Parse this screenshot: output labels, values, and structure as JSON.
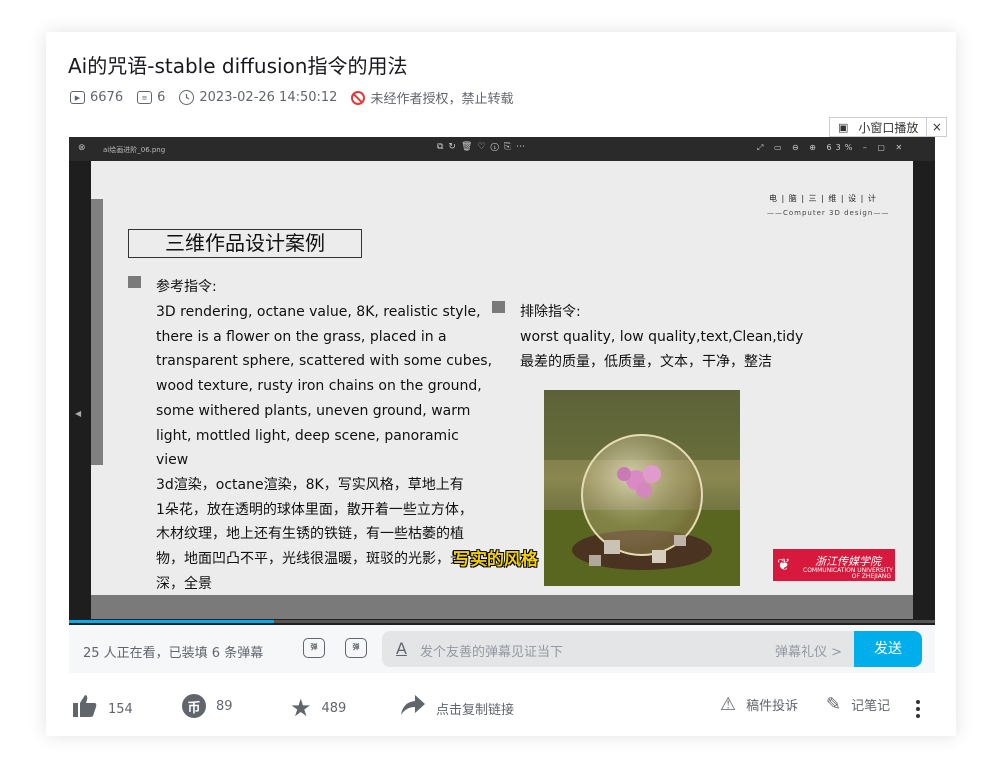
{
  "video": {
    "title": "Ai的咒语-stable diffusion指令的用法",
    "views": "6676",
    "danmaku_count": "6",
    "datetime": "2023-02-26 14:50:12",
    "copyright": "未经作者授权，禁止转载"
  },
  "player": {
    "mini_play_label": "小窗口播放",
    "mini_close": "×",
    "viewer_filename": "ai绘画进阶_06.png",
    "viewer_zoom": "63%",
    "progress_fraction": 0.237,
    "subtitle": "写实的风格"
  },
  "slide": {
    "brand_top": "电 | 脑 | 三 | 维 | 设 | 计",
    "brand_sub": "——Computer  3D design——",
    "heading": "三维作品设计案例",
    "prompt_label": "参考指令:",
    "prompt_lines": [
      "3D rendering, octane value, 8K, realistic style,",
      "there is a flower on the grass, placed in a",
      "transparent sphere, scattered with some cubes,",
      "wood texture, rusty iron chains on the ground,",
      "some withered plants, uneven ground, warm",
      "light, mottled light, deep scene, panoramic",
      "view",
      "3d渲染，octane渲染，8K，写实风格，草地上有",
      "1朵花，放在透明的球体里面，散开着一些立方体，",
      "木材纹理，地上还有生锈的铁链，有一些枯萎的植",
      "物，地面凹凸不平，光线很温暖，斑驳的光影，景",
      "深，全景"
    ],
    "negative_label": "排除指令:",
    "negative_lines": [
      "worst quality, low quality,text,Clean,tidy",
      "最差的质量，低质量，文本，干净，整洁"
    ],
    "logo_cn": "浙江传媒学院",
    "logo_en_1": "COMMUNICATION UNIVERSITY",
    "logo_en_2": "OF ZHEJIANG"
  },
  "danmaku_bar": {
    "viewers_text": "25 人正在看，已装填 6 条弹幕",
    "toggle_icon_1": "弹",
    "toggle_icon_2": "弹",
    "input_icon": "A",
    "placeholder": "发个友善的弹幕见证当下",
    "etiquette": "弹幕礼仪 >",
    "send": "发送"
  },
  "actions": {
    "like": "154",
    "coin": "89",
    "coin_glyph": "币",
    "favorite": "489",
    "share": "点击复制链接",
    "report": "稿件投诉",
    "notes": "记笔记"
  }
}
